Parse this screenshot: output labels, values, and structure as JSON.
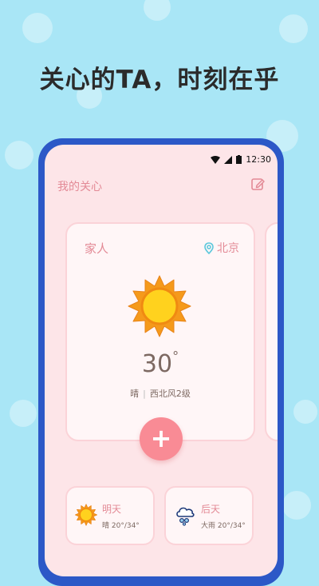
{
  "headline": "关心的TA，时刻在乎",
  "status_bar": {
    "time": "12:30"
  },
  "app": {
    "title": "我的关心"
  },
  "card": {
    "label": "家人",
    "location": "北京",
    "temperature": "30",
    "degree": "°",
    "condition": "晴",
    "wind": "西北风2级"
  },
  "add_button": {
    "label": "+"
  },
  "forecast": [
    {
      "day": "明天",
      "desc": "晴  20°/34°",
      "icon": "sun-icon"
    },
    {
      "day": "后天",
      "desc": "大雨  20°/34°",
      "icon": "heavy-rain-icon"
    }
  ],
  "colors": {
    "background": "#a9e6f6",
    "phone_frame": "#2c58c7",
    "screen": "#fde5e8",
    "accent_pink": "#f98b95",
    "text_pink": "#e38a96",
    "sun_orange": "#f59a1b",
    "sun_yellow": "#ffd21e"
  }
}
